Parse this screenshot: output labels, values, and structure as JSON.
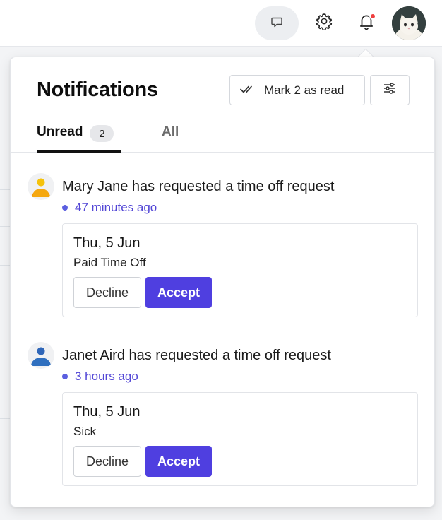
{
  "topbar": {
    "chat_icon": "chat-bubble-icon",
    "settings_icon": "gear-icon",
    "notifications_icon": "bell-icon",
    "unread_indicator_color": "#ef3f3f",
    "avatar": "user-avatar-cat"
  },
  "panel": {
    "title": "Notifications",
    "mark_read_label": "Mark 2 as read",
    "mark_read_icon": "double-check-icon",
    "filter_icon": "sliders-icon"
  },
  "tabs": {
    "unread_label": "Unread",
    "unread_count": "2",
    "all_label": "All"
  },
  "notifications": [
    {
      "message": "Mary Jane has requested a time off request",
      "time": "47 minutes ago",
      "date": "Thu, 5 Jun",
      "leave_type": "Paid Time Off",
      "decline_label": "Decline",
      "accept_label": "Accept",
      "avatar_color": "#f5b50a"
    },
    {
      "message": "Janet Aird has requested a time off request",
      "time": "3 hours ago",
      "date": "Thu, 5 Jun",
      "leave_type": "Sick",
      "decline_label": "Decline",
      "accept_label": "Accept",
      "avatar_color": "#2f6fbf"
    }
  ],
  "colors": {
    "accent": "#4f3fe0",
    "time_text": "#5347d6"
  }
}
